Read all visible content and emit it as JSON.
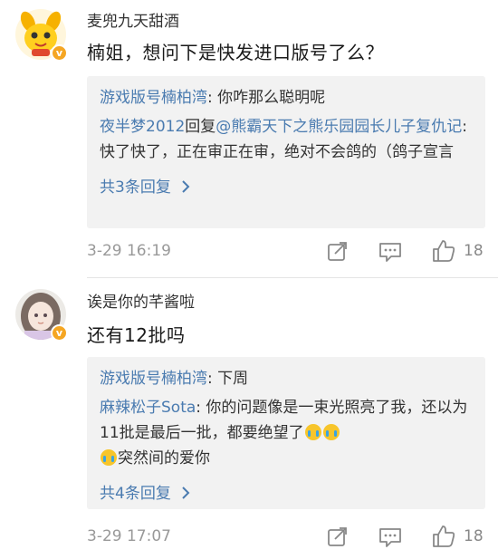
{
  "comments": [
    {
      "username": "麦兜九天甜酒",
      "text": "楠姐，想问下是快发进口版号了么？",
      "avatar_icon": "bunny-avatar",
      "verified_badge": "v",
      "replies": [
        {
          "name": "游戏版号楠柏湾",
          "text": ": 你咋那么聪明呢"
        },
        {
          "name": "夜半梦2012",
          "text": "回复",
          "mention": "@熊霸天下之熊乐园园长儿子复仇记",
          "text2": ":快了快了，正在审正在审，绝对不会鸽的（鸽子宣言"
        }
      ],
      "more_label": "共3条回复",
      "more_icon": "chevron-right-icon",
      "date": "3-29 16:19",
      "like_count": "18"
    },
    {
      "username": "诶是你的芊酱啦",
      "text": "还有12批吗",
      "avatar_icon": "anime-girl-avatar",
      "verified_badge": "v",
      "replies": [
        {
          "name": "游戏版号楠柏湾",
          "text": ": 下周"
        },
        {
          "name": "麻辣松子Sota",
          "text": ": 你的问题像是一束光照亮了我，还以为11批是最后一批，都要绝望了",
          "text2": "突然间的爱你"
        }
      ],
      "more_label": "共4条回复",
      "more_icon": "chevron-right-icon",
      "date": "3-29 17:07",
      "like_count": "18"
    }
  ],
  "icons": {
    "repost": "repost-icon",
    "comment": "comment-icon",
    "like": "thumbs-up-icon"
  },
  "colors": {
    "link": "#4a7bb0",
    "reply_bg": "#f2f2f2",
    "badge": "#f5a623",
    "meta": "#999999"
  }
}
